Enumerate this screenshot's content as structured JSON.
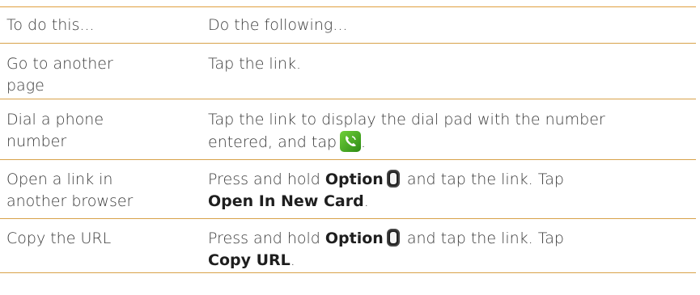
{
  "header": {
    "col1": "To do this...",
    "col2": "Do the following..."
  },
  "rows": [
    {
      "action_line1": "Go to another",
      "action_line2": "page",
      "instruction": "Tap the link."
    },
    {
      "action_line1": "Dial a phone",
      "action_line2": "number",
      "instruction_line1": "Tap the link to display the dial pad with the number",
      "instruction_line2": "entered, and tap",
      "icon": "phone-dial-icon"
    },
    {
      "action_line1": "Open a link in",
      "action_line2": "another browser",
      "pre": "Press and hold",
      "bold1": "Option",
      "mid": "and tap the link. Tap",
      "bold2": "Open In New Card",
      "end": ".",
      "icon": "option-key-icon"
    },
    {
      "action_line1": "Copy the URL",
      "pre": "Press and hold",
      "bold1": "Option",
      "mid": "and tap the link. Tap",
      "bold2": "Copy URL",
      "end": ".",
      "icon": "option-key-icon"
    }
  ],
  "colors": {
    "rule": "#d8a24a",
    "text": "#3a3a3a",
    "bold": "#1e1e1e"
  }
}
